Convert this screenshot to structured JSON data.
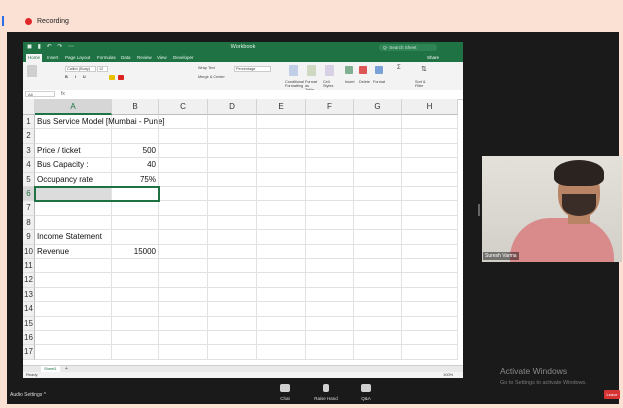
{
  "recording": {
    "label": "Recording"
  },
  "excel": {
    "title": "Workbook",
    "search_placeholder": "Q-  Search Sheet",
    "share_label": "Share",
    "tabs": [
      "Home",
      "Insert",
      "Page Layout",
      "Formulas",
      "Data",
      "Review",
      "View",
      "Developer"
    ],
    "font_name": "Calibri (Body)",
    "font_size": "12",
    "number_format": "Percentage",
    "wrap_text": "Wrap Text",
    "merge_center": "Merge & Center",
    "ribbon_labels": [
      "Conditional Formatting",
      "Format as Table",
      "Cell Styles",
      "Insert",
      "Delete",
      "Format",
      "Sort & Filter"
    ],
    "namebox": "A6",
    "fx_label": "fx",
    "columns": [
      "A",
      "B",
      "C",
      "D",
      "E",
      "F",
      "G",
      "H"
    ],
    "selected_column": "A",
    "selected_row": 6,
    "rows": [
      {
        "n": "1",
        "a": "Bus Service Model [Mumbai - Pune]",
        "b": ""
      },
      {
        "n": "2",
        "a": "",
        "b": ""
      },
      {
        "n": "3",
        "a": "Price / ticket",
        "b": "500"
      },
      {
        "n": "4",
        "a": "Bus Capacity :",
        "b": "40"
      },
      {
        "n": "5",
        "a": "Occupancy rate",
        "b": "75%"
      },
      {
        "n": "6",
        "a": "",
        "b": ""
      },
      {
        "n": "7",
        "a": "",
        "b": ""
      },
      {
        "n": "8",
        "a": "",
        "b": ""
      },
      {
        "n": "9",
        "a": "Income Statement",
        "b": ""
      },
      {
        "n": "10",
        "a": "Revenue",
        "b": "15000"
      },
      {
        "n": "11",
        "a": "",
        "b": ""
      },
      {
        "n": "12",
        "a": "",
        "b": ""
      },
      {
        "n": "13",
        "a": "",
        "b": ""
      },
      {
        "n": "14",
        "a": "",
        "b": ""
      },
      {
        "n": "15",
        "a": "",
        "b": ""
      },
      {
        "n": "16",
        "a": "",
        "b": ""
      },
      {
        "n": "17",
        "a": "",
        "b": ""
      }
    ],
    "sheet_tab": "Sheet1",
    "add_sheet": "+",
    "status_ready": "Ready",
    "zoom_level": "100%"
  },
  "webcam": {
    "name": "Suresh Varma"
  },
  "watermark": {
    "line1": "Activate Windows",
    "line2": "Go to Settings to activate Windows."
  },
  "zoom_controls": {
    "audio": "Audio Settings ^",
    "chat": "Chat",
    "raise_hand": "Raise Hand",
    "qa": "Q&A",
    "leave": "Leave"
  },
  "colors": {
    "excel_green": "#1f7244",
    "rec_red": "#e02828"
  }
}
